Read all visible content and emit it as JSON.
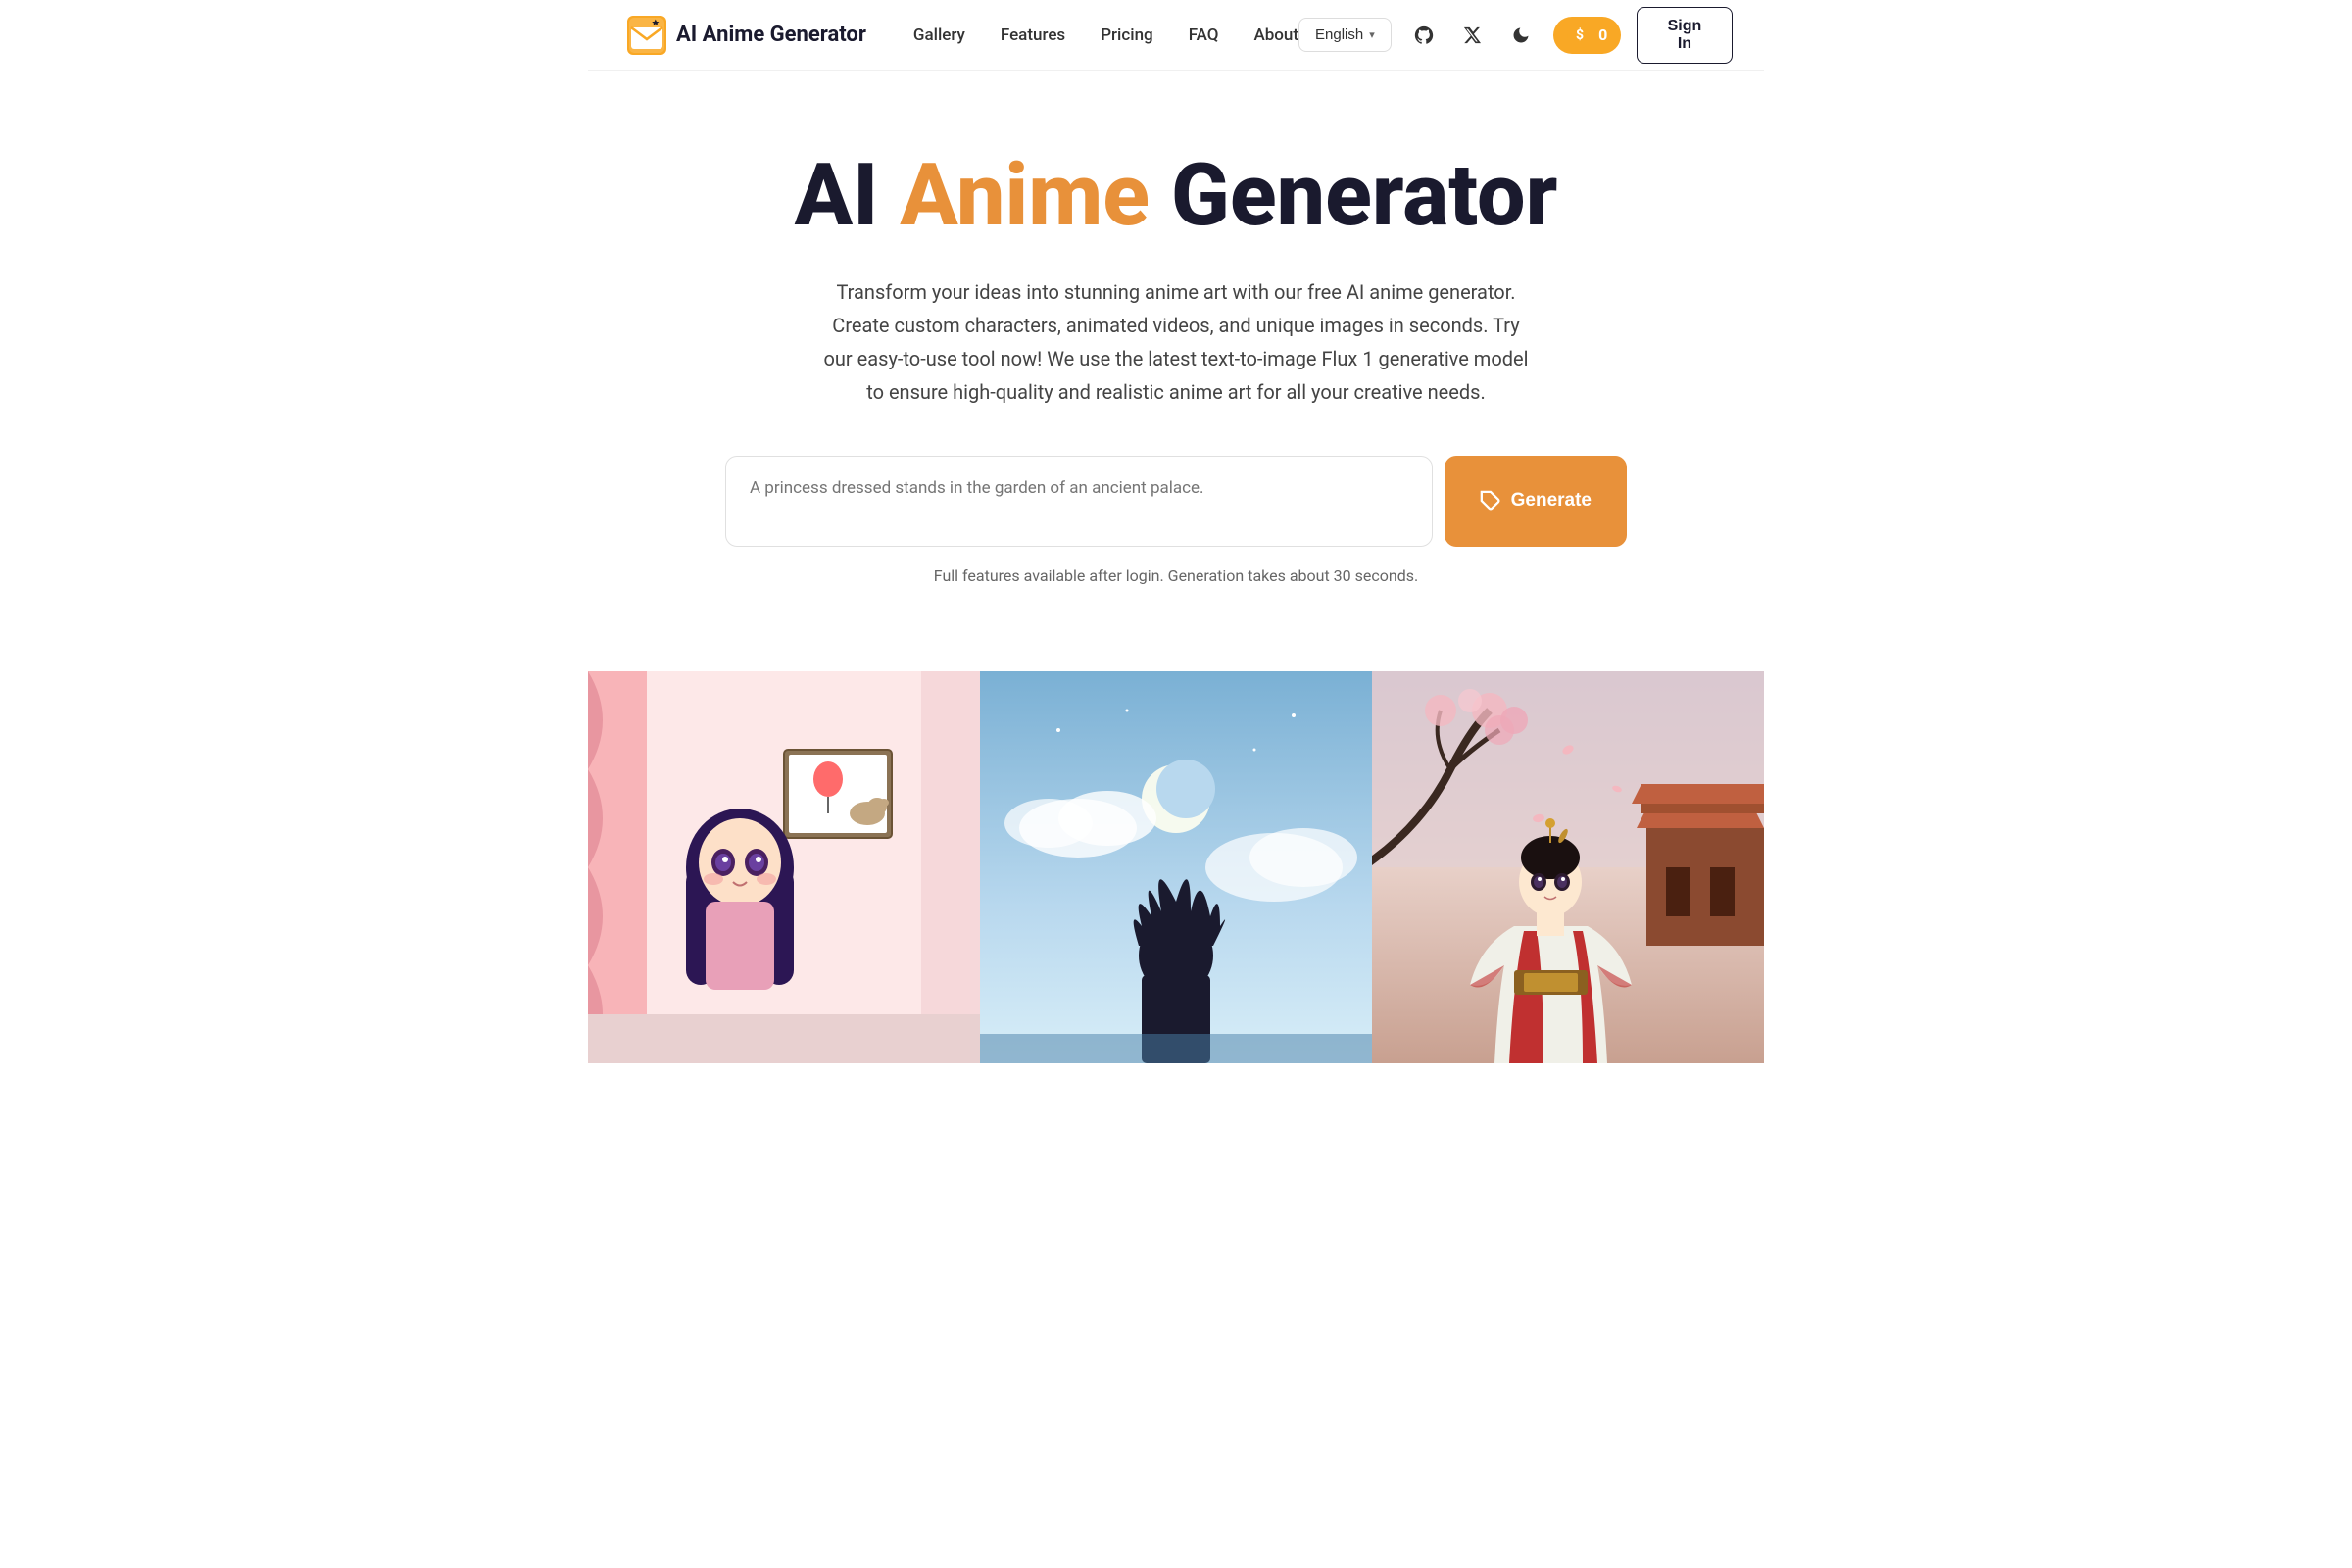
{
  "navbar": {
    "logo_text": "AI Anime Generator",
    "nav_links": [
      {
        "label": "Gallery",
        "id": "gallery"
      },
      {
        "label": "Features",
        "id": "features"
      },
      {
        "label": "Pricing",
        "id": "pricing"
      },
      {
        "label": "FAQ",
        "id": "faq"
      },
      {
        "label": "About",
        "id": "about"
      }
    ],
    "language": "English",
    "language_chevron": "▾",
    "coin_count": "0",
    "sign_in": "Sign In"
  },
  "hero": {
    "title_part1": "AI ",
    "title_highlight": "Anime",
    "title_part2": " Generator",
    "subtitle": "Transform your ideas into stunning anime art with our free AI anime generator. Create custom characters, animated videos, and unique images in seconds. Try our easy-to-use tool now! We use the latest text-to-image Flux 1 generative model to ensure high-quality and realistic anime art for all your creative needs.",
    "input_placeholder": "A princess dressed stands in the garden of an ancient palace.",
    "generate_label": "Generate",
    "feature_note": "Full features available after login. Generation takes about 30 seconds."
  },
  "gallery": {
    "images": [
      {
        "alt": "Anime girl in room with pink curtains"
      },
      {
        "alt": "Anime character silhouette against sky"
      },
      {
        "alt": "Anime woman in traditional Japanese clothing"
      }
    ]
  },
  "icons": {
    "github": "⌥",
    "twitter_x": "✕",
    "moon": "☽",
    "dollar": "$",
    "tag": "⬡"
  }
}
